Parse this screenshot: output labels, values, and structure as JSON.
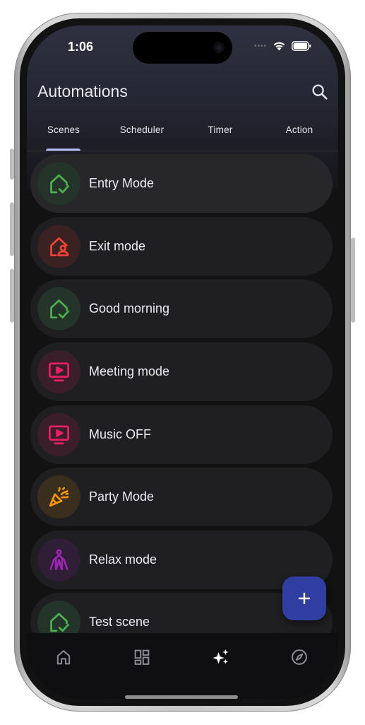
{
  "status_bar": {
    "time": "1:06",
    "signal_dots": "••••"
  },
  "header": {
    "title": "Automations"
  },
  "tabs": [
    {
      "label": "Scenes",
      "selected": true
    },
    {
      "label": "Scheduler",
      "selected": false
    },
    {
      "label": "Timer",
      "selected": false
    },
    {
      "label": "Action",
      "selected": false
    }
  ],
  "scenes": [
    {
      "label": "Entry Mode",
      "icon": "home-check-icon",
      "color": "#4caf50",
      "bg": "#24342a"
    },
    {
      "label": "Exit mode",
      "icon": "home-person-icon",
      "color": "#f44336",
      "bg": "#3a2222"
    },
    {
      "label": "Good morning",
      "icon": "home-check-icon",
      "color": "#4caf50",
      "bg": "#24342a"
    },
    {
      "label": "Meeting mode",
      "icon": "tv-play-icon",
      "color": "#e91e63",
      "bg": "#3a1e29"
    },
    {
      "label": "Music OFF",
      "icon": "tv-play-icon",
      "color": "#e91e63",
      "bg": "#3a1e29"
    },
    {
      "label": "Party Mode",
      "icon": "party-popper-icon",
      "color": "#ff9800",
      "bg": "#3a2e1e"
    },
    {
      "label": "Relax mode",
      "icon": "meditation-icon",
      "color": "#9c27b0",
      "bg": "#2f1e36"
    },
    {
      "label": "Test scene",
      "icon": "home-check-icon",
      "color": "#4caf50",
      "bg": "#24342a"
    }
  ],
  "fab": {
    "icon": "plus-icon"
  },
  "bottom_nav": [
    {
      "icon": "home-icon",
      "selected": false
    },
    {
      "icon": "dashboard-icon",
      "selected": false
    },
    {
      "icon": "sparkles-icon",
      "selected": true
    },
    {
      "icon": "compass-icon",
      "selected": false
    }
  ]
}
